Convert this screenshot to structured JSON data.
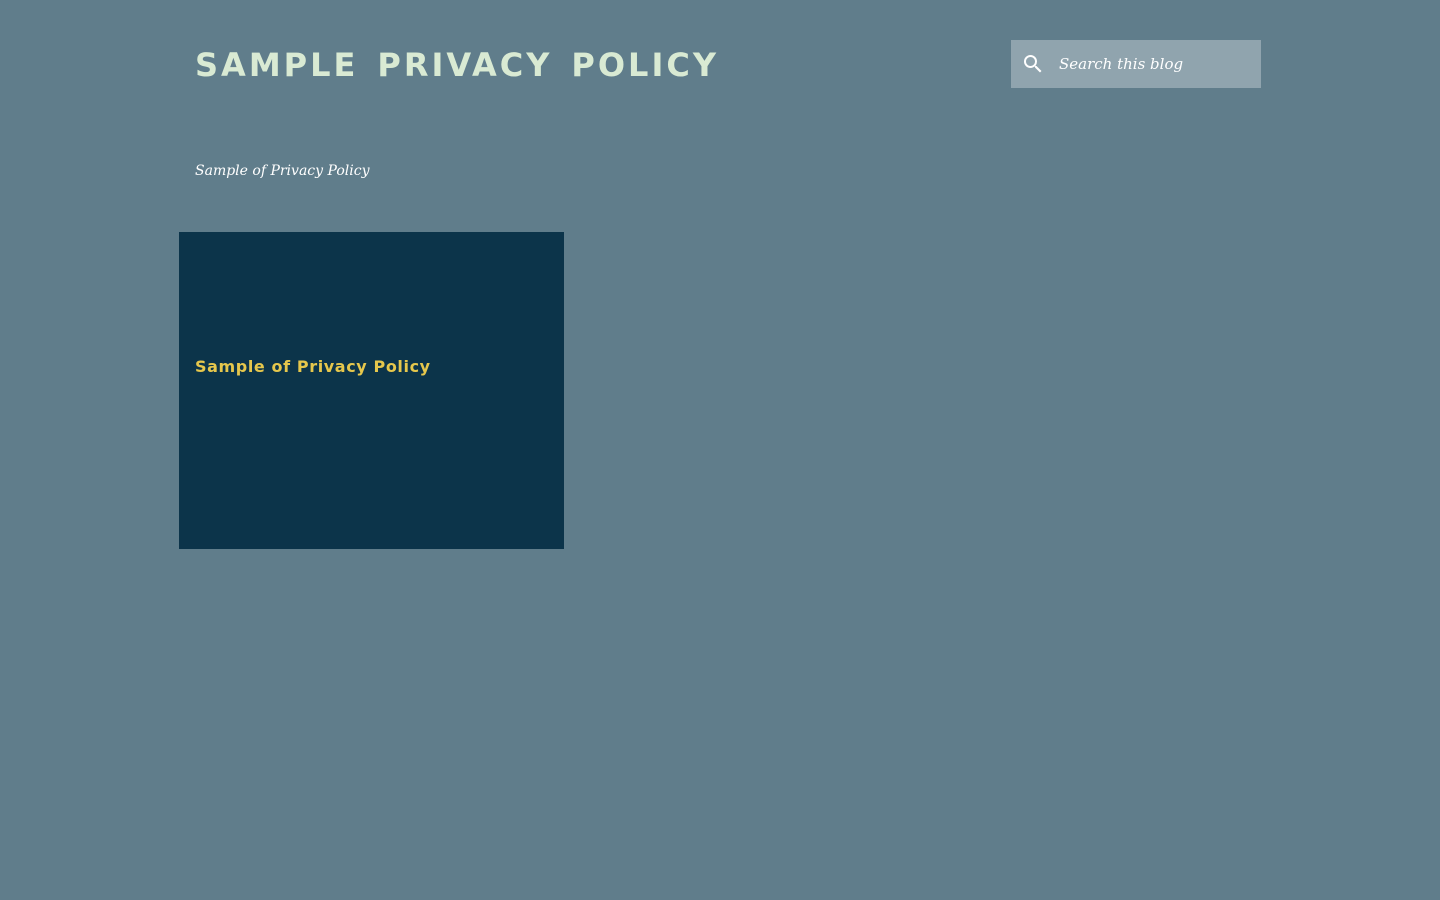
{
  "header": {
    "title": "Sample Privacy Policy",
    "description": "Sample of Privacy Policy"
  },
  "search": {
    "placeholder": "Search this blog",
    "icon": "search-icon"
  },
  "posts": [
    {
      "title": "Sample of Privacy Policy"
    }
  ],
  "colors": {
    "background": "#607d8b",
    "title": "#d9ead3",
    "search_background": "#90a4ae",
    "card_background": "#0c344a",
    "post_title": "#e6c74c"
  }
}
